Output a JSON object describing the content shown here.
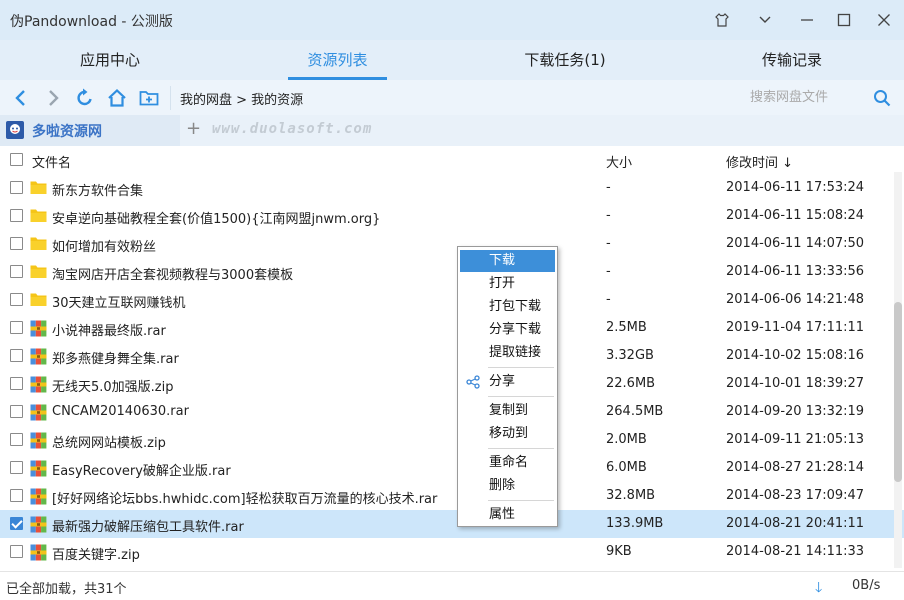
{
  "window": {
    "title": "伪Pandownload - 公测版"
  },
  "tabs": [
    {
      "label": "应用中心"
    },
    {
      "label": "资源列表"
    },
    {
      "label": "下载任务(1)"
    },
    {
      "label": "传输记录"
    }
  ],
  "active_tab": "资源列表",
  "toolbar": {
    "breadcrumb": "我的网盘 > 我的资源",
    "search_placeholder": "搜索网盘文件"
  },
  "site_tab": {
    "name": "多啦资源网",
    "watermark": "www.duolasoft.com"
  },
  "columns": {
    "name": "文件名",
    "size": "大小",
    "modified": "修改时间 ↓"
  },
  "files": [
    {
      "name": "新东方软件合集",
      "type": "folder",
      "size": "-",
      "modified": "2014-06-11 17:53:24"
    },
    {
      "name": "安卓逆向基础教程全套(价值1500){江南网盟jnwm.org}",
      "type": "folder",
      "size": "-",
      "modified": "2014-06-11 15:08:24"
    },
    {
      "name": "如何增加有效粉丝",
      "type": "folder",
      "size": "-",
      "modified": "2014-06-11 14:07:50"
    },
    {
      "name": "淘宝网店开店全套视频教程与3000套模板",
      "type": "folder",
      "size": "-",
      "modified": "2014-06-11 13:33:56"
    },
    {
      "name": "30天建立互联网赚钱机",
      "type": "folder",
      "size": "-",
      "modified": "2014-06-06 14:21:48"
    },
    {
      "name": "小说神器最终版.rar",
      "type": "archive",
      "size": "2.5MB",
      "modified": "2019-11-04 17:11:11"
    },
    {
      "name": "郑多燕健身舞全集.rar",
      "type": "archive",
      "size": "3.32GB",
      "modified": "2014-10-02 15:08:16"
    },
    {
      "name": "无线天5.0加强版.zip",
      "type": "archive",
      "size": "22.6MB",
      "modified": "2014-10-01 18:39:27"
    },
    {
      "name": "CNCAM20140630.rar",
      "type": "archive",
      "size": "264.5MB",
      "modified": "2014-09-20 13:32:19"
    },
    {
      "name": "总统网网站模板.zip",
      "type": "archive",
      "size": "2.0MB",
      "modified": "2014-09-11 21:05:13"
    },
    {
      "name": "EasyRecovery破解企业版.rar",
      "type": "archive",
      "size": "6.0MB",
      "modified": "2014-08-27 21:28:14"
    },
    {
      "name": "[好好网络论坛bbs.hwhidc.com]轻松获取百万流量的核心技术.rar",
      "type": "archive",
      "size": "32.8MB",
      "modified": "2014-08-23 17:09:47"
    },
    {
      "name": "最新强力破解压缩包工具软件.rar",
      "type": "archive",
      "size": "133.9MB",
      "modified": "2014-08-21 20:41:11",
      "selected": true
    },
    {
      "name": "百度关键字.zip",
      "type": "archive",
      "size": "9KB",
      "modified": "2014-08-21 14:11:33"
    }
  ],
  "context_menu": {
    "items": [
      "下载",
      "打开",
      "打包下载",
      "分享下载",
      "提取链接",
      "分享",
      "复制到",
      "移动到",
      "重命名",
      "删除",
      "属性"
    ],
    "highlighted": "下载"
  },
  "status": {
    "summary": "已全部加载，共31个",
    "speed": "0B/s"
  },
  "colors": {
    "accent": "#2f8ee0",
    "folder": "#f5c518",
    "selected_row": "#cde6fa",
    "menu_highlight": "#3d8fd9"
  }
}
